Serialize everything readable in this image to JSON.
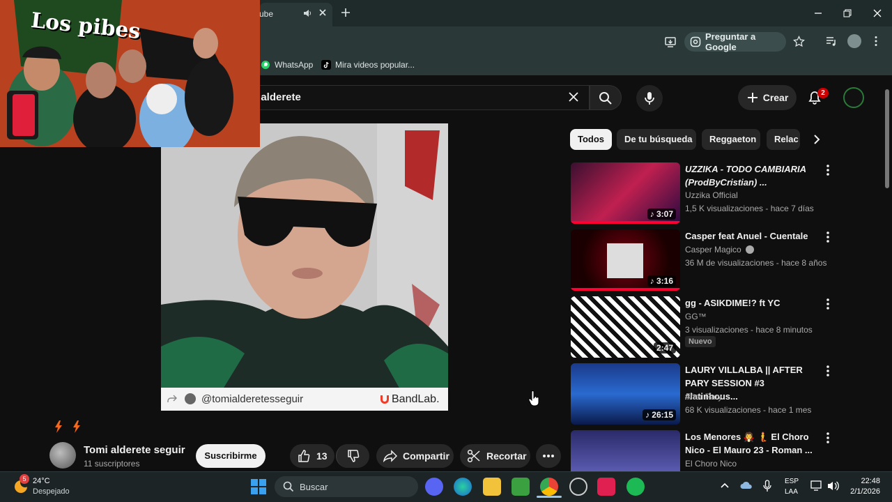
{
  "browser": {
    "tab_title": "ube",
    "ask_google": "Preguntar a Google",
    "bookmarks": [
      "WhatsApp",
      "Mira videos popular..."
    ]
  },
  "youtube": {
    "search_query": "i alderete",
    "create_label": "Crear",
    "notification_count": "2",
    "chips": [
      "Todos",
      "De tu búsqueda",
      "Reggaeton",
      "Relac"
    ],
    "video": {
      "bandlab_user": "@tomialderetesseguir",
      "bandlab_brand": "BandLab.",
      "channel_name": "Tomi alderete seguir",
      "subscribers": "11 suscriptores",
      "subscribe_label": "Suscribirme",
      "likes": "13",
      "share_label": "Compartir",
      "clip_label": "Recortar"
    },
    "related": [
      {
        "title": "UZZIKA - TODO CAMBIARIA (ProdByCristian) ...",
        "channel": "Uzzika Official",
        "meta": "1,5 K visualizaciones - hace 7 días",
        "duration": "3:07",
        "verified": false
      },
      {
        "title": "Casper feat Anuel - Cuentale",
        "channel": "Casper Magico",
        "meta": "36 M de visualizaciones - hace 8 años",
        "duration": "3:16",
        "verified": true
      },
      {
        "title": "gg - ASIKDIME!? ft YC",
        "channel": "GG™",
        "meta": "3 visualizaciones - hace 8 minutos",
        "duration": "2:47",
        "badge": "Nuevo"
      },
      {
        "title": "LAURY VILLALBA || AFTER PARY SESSION #3 #latinhous...",
        "channel": "After Pary",
        "meta": "68 K visualizaciones - hace 1 mes",
        "duration": "26:15"
      },
      {
        "title": "Los Menores 🧛 🧜 El Choro Nico - El Mauro 23 - Roman ...",
        "channel": "El Choro Nico",
        "meta": "",
        "duration": ""
      }
    ]
  },
  "webcam": {
    "banner_text": "Los pibes"
  },
  "taskbar": {
    "weather_temp": "24°C",
    "weather_desc": "Despejado",
    "weather_badge": "5",
    "search_label": "Buscar",
    "lang_line1": "ESP",
    "lang_line2": "LAA",
    "time": "22:48",
    "date": "2/1/2026"
  }
}
